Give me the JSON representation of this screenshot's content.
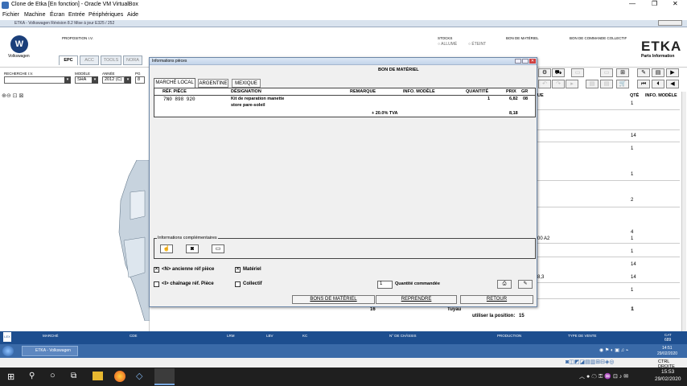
{
  "vbox": {
    "title": "Clone de Etka [En fonction] - Oracle VM VirtualBox",
    "menu": [
      "Fichier",
      "Machine",
      "Écran",
      "Entrée",
      "Périphériques",
      "Aide"
    ]
  },
  "guest_title": "ETKA - Volkswagen Révision 8.2 Mise à jour E325 / 252",
  "header": {
    "brand": "Volkswagen",
    "proposition": "PROPOSITION I.V.",
    "stocks": "STOCKS",
    "allume": "ALLUMÉ",
    "eteint": "ÉTEINT",
    "bon_materiel": "BON DE MATÉRIEL",
    "bon_commande": "BON DE COMMANDE COLLECTIF",
    "etka": "ETKA",
    "etka_sub": "Parts Information",
    "tabs": [
      "EPC",
      "ACC",
      "TOOLS",
      "NORA"
    ]
  },
  "filters": {
    "recherche_label": "RECHERCHE I.V.",
    "modele_label": "MODÈLE",
    "modele_value": "SHA",
    "annee_label": "ANNÉE",
    "annee_value": "2012 (C)",
    "pg_label": "PG",
    "pg_value": "8"
  },
  "right_list": {
    "col_header_remark": "UE",
    "col_qte": "QTÉ",
    "col_info": "INFO. MODÈLE",
    "qtys": [
      "1",
      "14",
      "1",
      "1",
      "2",
      "4",
      "1",
      "1",
      "14",
      "14",
      "1",
      "1"
    ],
    "side_texts": [
      "00 A2",
      "8,3"
    ]
  },
  "background_row": {
    "pos": "16",
    "name": "Tuyau",
    "use_label": "utiliser la position:",
    "use_value": "15"
  },
  "statusbar": [
    "MARCHÉ",
    "CDE",
    "LRM",
    "LBV",
    "KC",
    "N° DE CHÂSSIS",
    "PRODUCTION",
    "TYPE DE VENTE",
    "CAT",
    "689"
  ],
  "guest_task": {
    "item": "ETKA - Volkswagen",
    "time": "14:51",
    "date": "29/02/2020"
  },
  "vbox_status": "CTRL DROITE",
  "win_task": {
    "time": "15:53",
    "date": "29/02/2020"
  },
  "dialog": {
    "title": "Informations pièces",
    "heading": "BON DE MATÉRIEL",
    "tabs": [
      "MARCHÉ LOCAL",
      "ARGENTINE",
      "MEXIQUE"
    ],
    "columns": [
      "RÉF. PIÈCE",
      "DÉSIGNATION",
      "REMARQUE",
      "INFO. MODÈLE",
      "QUANTITÉ",
      "PRIX",
      "GR"
    ],
    "row": {
      "ref": "7N0 898 920",
      "designation1": "Kit de reparation manette",
      "designation2": "store pare-soleil",
      "quantite": "1",
      "prix": "6,82",
      "gr": "08"
    },
    "tva_label": "+ 20.0% TVA",
    "tva_total": "8,18",
    "info_comp": "Informations complémentaires",
    "cb_ancienne": "<N> ancienne réf pièce",
    "cb_materiel": "Matériel",
    "cb_chainage": "<I> chaînage réf. Pièce",
    "cb_collectif": "Collectif",
    "qty_value": "1",
    "qty_label": "Quantité commandée",
    "btn_bons": "BONS DE MATÉRIEL",
    "btn_reprendre": "REPRENDRE",
    "btn_retour": "RETOUR"
  }
}
